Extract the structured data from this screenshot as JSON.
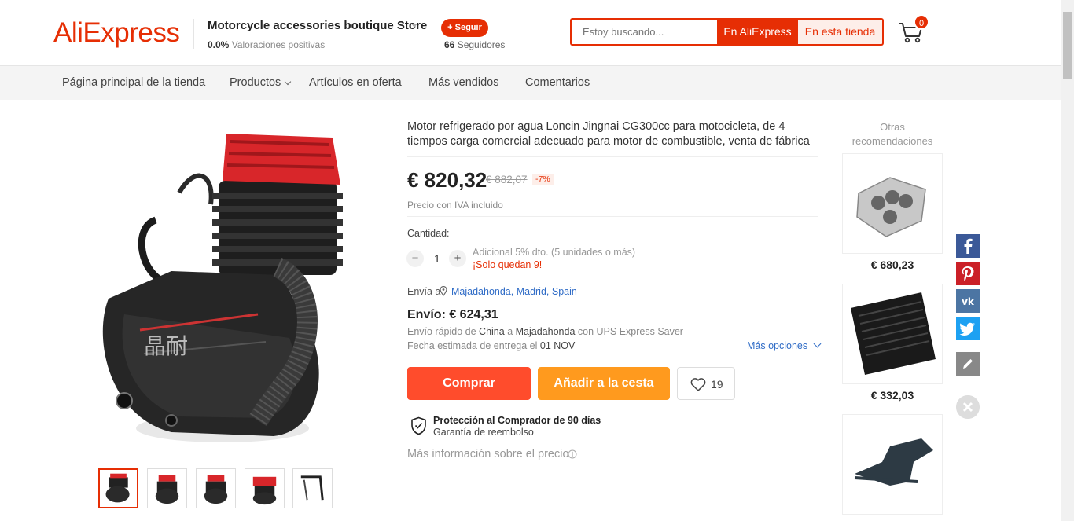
{
  "header": {
    "logo": "AliExpress",
    "store_name": "Motorcycle accessories boutique Store",
    "ratings_value": "0.0%",
    "ratings_label": "Valoraciones positivas",
    "follow_label": "+ Seguir",
    "followers_count": "66",
    "followers_label": "Seguidores",
    "search_placeholder": "Estoy buscando...",
    "search_aliexpress": "En AliExpress",
    "search_store": "En esta tienda",
    "cart_count": "0"
  },
  "nav": {
    "items": [
      {
        "label": "Página principal de la tienda"
      },
      {
        "label": "Productos"
      },
      {
        "label": "Artículos en oferta"
      },
      {
        "label": "Más vendidos"
      },
      {
        "label": "Comentarios"
      }
    ]
  },
  "product": {
    "title": "Motor refrigerado por agua Loncin Jingnai CG300cc para motocicleta, de 4 tiempos carga comercial adecuado para motor de combustible, venta de fábrica",
    "price": "€ 820,32",
    "old_price": "€ 882,07",
    "discount": "-7%",
    "vat_note": "Precio con IVA incluido",
    "quantity_label": "Cantidad:",
    "quantity_value": "1",
    "additional_discount": "Adicional 5% dto. (5 unidades o más)",
    "stock_left": "¡Solo quedan 9!",
    "ship_to_label": "Envía a",
    "ship_to_location": "Majadahonda, Madrid, Spain",
    "shipping_cost": "Envío: € 624,31",
    "ship_desc_1": "Envío rápido de",
    "ship_from": "China",
    "ship_desc_2": "a",
    "ship_dest": "Majadahonda",
    "ship_desc_3": "con UPS Express Saver",
    "eta_label": "Fecha estimada de entrega el",
    "eta_date": "01 NOV",
    "more_options": "Más opciones",
    "buy_label": "Comprar",
    "add_cart_label": "Añadir a la cesta",
    "wishlist_count": "19",
    "protection_title": "Protección al Comprador de 90 días",
    "protection_sub": "Garantía de reembolso",
    "more_info": "Más información sobre el precio"
  },
  "recommendations": {
    "title": "Otras recomendaciones",
    "items": [
      {
        "price": "€ 680,23"
      },
      {
        "price": "€ 332,03"
      },
      {
        "price": ""
      }
    ]
  },
  "social": [
    "facebook-icon",
    "pinterest-icon",
    "vk-icon",
    "twitter-icon",
    "edit-icon",
    "close-icon"
  ],
  "colors": {
    "brand": "#e62e04",
    "buy": "#ff4c2c",
    "add_cart": "#ff9a1e",
    "link": "#2e6bc6"
  }
}
